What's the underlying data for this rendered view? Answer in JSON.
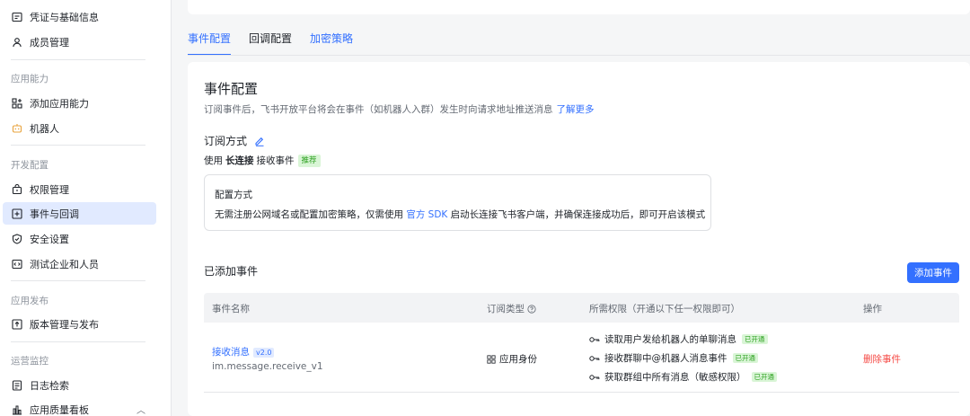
{
  "sidebar": {
    "items_top": [
      {
        "label": "凭证与基础信息",
        "icon": "credential-icon"
      },
      {
        "label": "成员管理",
        "icon": "user-icon"
      }
    ],
    "groups": [
      {
        "label": "应用能力",
        "items": [
          {
            "label": "添加应用能力",
            "icon": "apps-add-icon"
          },
          {
            "label": "机器人",
            "icon": "robot-icon"
          }
        ]
      },
      {
        "label": "开发配置",
        "items": [
          {
            "label": "权限管理",
            "icon": "lock-icon"
          },
          {
            "label": "事件与回调",
            "icon": "event-icon",
            "active": true
          },
          {
            "label": "安全设置",
            "icon": "shield-icon"
          },
          {
            "label": "测试企业和人员",
            "icon": "test-icon"
          }
        ]
      },
      {
        "label": "应用发布",
        "items": [
          {
            "label": "版本管理与发布",
            "icon": "upload-icon"
          }
        ]
      },
      {
        "label": "运营监控",
        "items": [
          {
            "label": "日志检索",
            "icon": "log-icon"
          },
          {
            "label": "应用质量看板",
            "icon": "chart-icon"
          }
        ]
      }
    ]
  },
  "tabs": [
    {
      "label": "事件配置",
      "active": true
    },
    {
      "label": "回调配置",
      "active": false
    },
    {
      "label": "加密策略",
      "active": false
    }
  ],
  "main": {
    "title": "事件配置",
    "description": "订阅事件后，飞书开放平台将会在事件（如机器人入群）发生时向请求地址推送消息",
    "learn_more": "了解更多",
    "subscribe_title": "订阅方式",
    "mode_prefix": "使用",
    "mode_name": "长连接",
    "mode_suffix": "接收事件",
    "recommend_tag": "推荐",
    "config_box": {
      "title": "配置方式",
      "text_before": "无需注册公网域名或配置加密策略，仅需使用",
      "link": "官方 SDK",
      "text_after": "启动长连接飞书客户端，并确保连接成功后，即可开启该模式"
    },
    "added_title": "已添加事件",
    "add_button": "添加事件"
  },
  "table": {
    "headers": {
      "name": "事件名称",
      "type": "订阅类型",
      "perm": "所需权限（开通以下任一权限即可）",
      "op": "操作"
    },
    "rows": [
      {
        "name": "接收消息",
        "version": "v2.0",
        "code": "im.message.receive_v1",
        "type": "应用身份",
        "permissions": [
          {
            "label": "读取用户发给机器人的单聊消息",
            "status": "已开通"
          },
          {
            "label": "接收群聊中@机器人消息事件",
            "status": "已开通"
          },
          {
            "label": "获取群组中所有消息（敏感权限）",
            "status": "已开通"
          }
        ],
        "action": "删除事件"
      }
    ]
  },
  "colors": {
    "accent": "#3370ff",
    "danger": "#f54a45",
    "success": "#2ea121"
  }
}
